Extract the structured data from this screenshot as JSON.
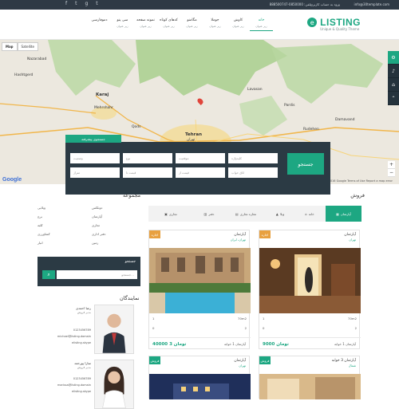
{
  "topbar": {
    "email": "info@30template.com",
    "phone": "تلفن: 0850000-888500747",
    "login": "ورود به حساب کاربری",
    "socials": [
      "facebook-icon",
      "twitter-icon",
      "google-plus-icon",
      "twitter-icon"
    ]
  },
  "logo": {
    "word": "LISTING",
    "tagline": "Unique & Quality Theme"
  },
  "nav": [
    {
      "label": "خانه",
      "sub": "زیر عنوان"
    },
    {
      "label": "کاوش",
      "sub": "زیر عنوان"
    },
    {
      "label": "جوملا",
      "sub": "زیر عنوان"
    },
    {
      "label": "مگامنو",
      "sub": "زیر عنوان"
    },
    {
      "label": "کدهای کوتاه",
      "sub": "زیر عنوان"
    },
    {
      "label": "نمونه صفحه",
      "sub": "زیر عنوان"
    },
    {
      "label": "سی پنو",
      "sub": "زیر عنوان"
    },
    {
      "label": "دموفارسی",
      "sub": ""
    }
  ],
  "map": {
    "buttons": [
      "Map",
      "Satellite"
    ],
    "google": "Google",
    "terms": "Map data ©2016 Google   Terms of Use   Report a map error",
    "cities": [
      "Nazarabad",
      "Hashtgerd",
      "Karaj",
      "Tehran",
      "تهران",
      "Baghestan",
      "Qods",
      "Shahriar",
      "Mehrshahr",
      "Eslamshahr",
      "Damavand",
      "Pardis",
      "Rudehen",
      "Lavasan"
    ]
  },
  "search": {
    "tab": "جستجوی پیشرفته",
    "submit": "جستجو",
    "fields": [
      "کلیدواژه",
      "موقعیت",
      "نوع",
      "وضعیت",
      "اتاق خواب",
      "قیمت از",
      "قیمت تا",
      "متراژ",
      "حمام",
      "پارکینگ"
    ]
  },
  "categories": {
    "title": "فروش",
    "tabs": [
      "آپارتمان",
      "خانه",
      "ویلا",
      "مغازه تجاری",
      "دفتر",
      "تجاری"
    ]
  },
  "collection": {
    "title": "مجموعه",
    "items": [
      "آپارتمان",
      "دوبلکس",
      "ویلایی",
      "تجاری",
      "برج",
      "دفتر اداری",
      "کلبه",
      "زمین",
      "کشاورزی",
      "انبار"
    ]
  },
  "sidebox": {
    "label": "جستجو",
    "placeholder": "جستجو..."
  },
  "listings": [
    {
      "badge": "اجاره",
      "badge_color": "#e8a040",
      "title": "آپارتمان",
      "location": "تهران، ایران",
      "area": "70m2",
      "rooms": "2",
      "baths": "1",
      "parking": "0",
      "price": "تومان 3 40000",
      "ptype": "آپارتمان 1 خوابه"
    },
    {
      "badge": "اجاره",
      "badge_color": "#e8a040",
      "title": "آپارتمان",
      "location": "تهران",
      "area": "70m2",
      "rooms": "2",
      "baths": "1",
      "parking": "0",
      "price": "تومان 9000",
      "ptype": "آپارتمان 1 خوابه"
    },
    {
      "badge": "فروش",
      "badge_color": "#1da782",
      "title": "آپارتمان",
      "location": "تهران",
      "area": "",
      "rooms": "",
      "baths": "",
      "parking": "",
      "price": "",
      "ptype": ""
    },
    {
      "badge": "فروش",
      "badge_color": "#1da782",
      "title": "آپارتمان 3 خوابه",
      "location": "شمال",
      "area": "",
      "rooms": "",
      "baths": "",
      "parking": "",
      "price": "",
      "ptype": ""
    }
  ],
  "agents_title": "نمایندگان",
  "agents": [
    {
      "name": "رضا احمدی",
      "role": "مدیر فروش",
      "phone": "0123456789",
      "email": "michael@listing.domain",
      "skype": "elisting.skype"
    },
    {
      "name": "سارا پورحمد",
      "role": "مدیر فروش",
      "phone": "0123456789",
      "email": "marissa@listing.domain",
      "skype": "elisting.skype"
    }
  ]
}
